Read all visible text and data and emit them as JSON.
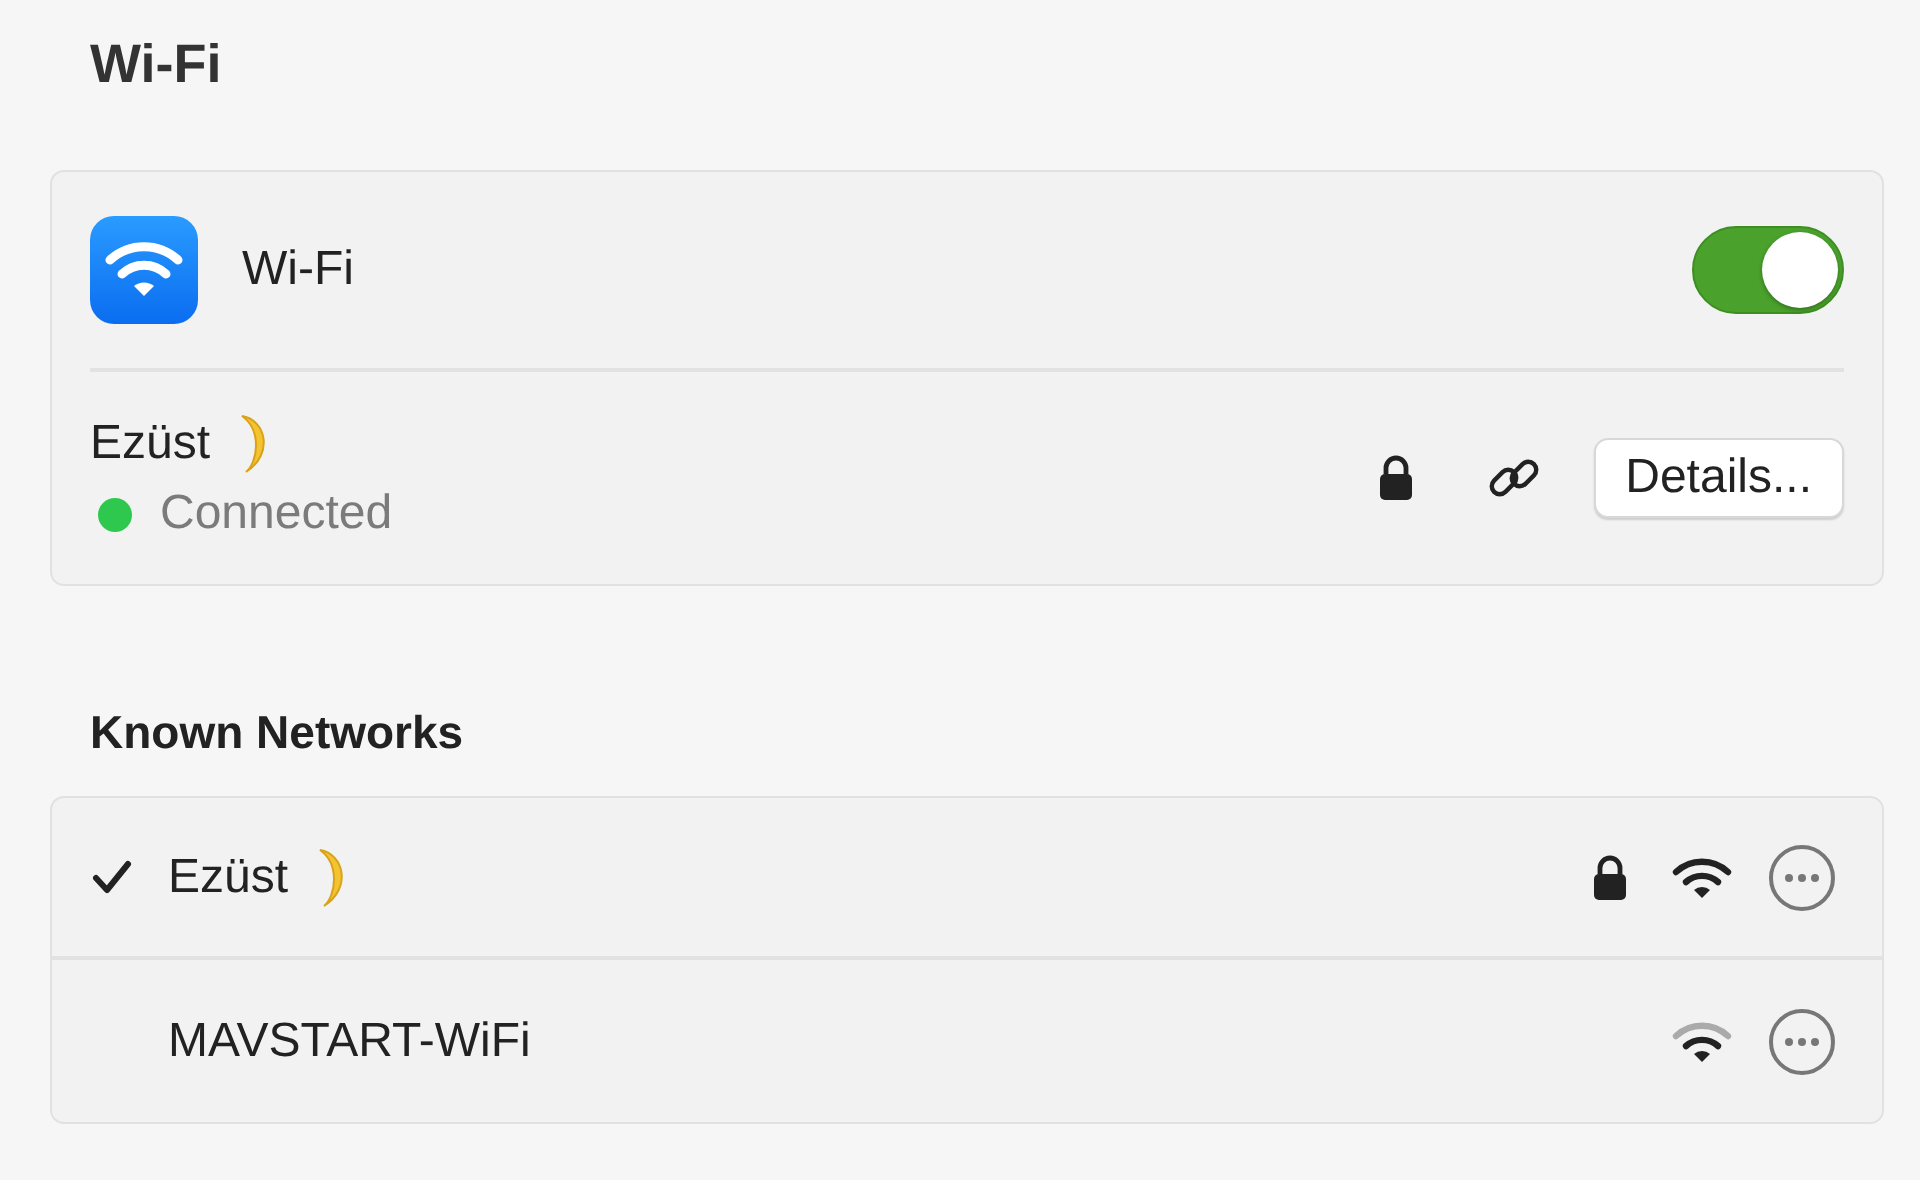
{
  "title": "Wi-Fi",
  "wifi": {
    "label": "Wi-Fi",
    "on": true
  },
  "current": {
    "name": "Ezüst",
    "status": "Connected",
    "color": "#2dc84d",
    "secured": true,
    "button": "Details..."
  },
  "known_heading": "Known Networks",
  "known": [
    {
      "name": "Ezüst",
      "selected": true,
      "secured": true,
      "kind": "strong"
    },
    {
      "name": "MAVSTART-WiFi",
      "selected": false,
      "secured": false,
      "kind": "weak"
    }
  ]
}
